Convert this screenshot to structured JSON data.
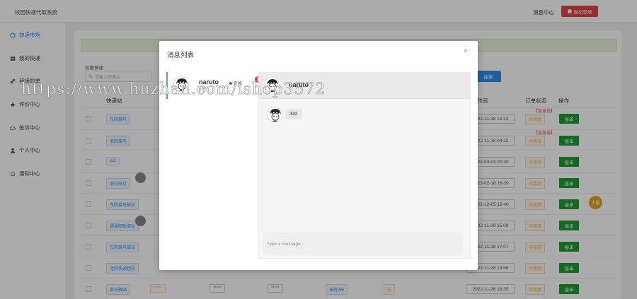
{
  "app": {
    "title": "校园快递代取系统",
    "message_center": "消息中心",
    "logout": "退出登录"
  },
  "sidebar": {
    "items": [
      {
        "label": "快递市场",
        "icon": "compass-icon",
        "active": true
      },
      {
        "label": "我的快递",
        "icon": "box-icon"
      },
      {
        "label": "我接的单",
        "icon": "link-icon"
      },
      {
        "label": "评价中心",
        "icon": "star-icon"
      },
      {
        "label": "投诉中心",
        "icon": "cloud-icon"
      },
      {
        "label": "个人中心",
        "icon": "user-icon"
      },
      {
        "label": "通知中心",
        "icon": "bell-icon"
      }
    ]
  },
  "search": {
    "label": "检索快递",
    "placeholder": "请输入快递点",
    "button": "搜索"
  },
  "table": {
    "headers": {
      "station": "快递站",
      "time": "时间",
      "status": "订单状态",
      "action": "操作"
    },
    "rows": [
      {
        "station": "东院菜鸟",
        "time": "2022-11-28 12:24",
        "status": "待接单",
        "urgent": "【加急送】",
        "action": "接单"
      },
      {
        "station": "南院菜鸟",
        "time": "2022-11-28 04:22",
        "status": "待接单",
        "urgent": "【加急送】",
        "action": "接单"
      },
      {
        "station": "xxz",
        "time": "2023-03-03 20:20",
        "status": "待接单",
        "action": "接单"
      },
      {
        "station": "测试支付",
        "time": "2023-02-18 16:39",
        "status": "待接单",
        "action": "接单"
      },
      {
        "station": "东院菜鸟驿站",
        "time": "2022-12-05 16:40",
        "status": "待接单",
        "action": "接单"
      },
      {
        "station": "圆通邮政驿站",
        "time": "2022-11-29 15:09",
        "status": "待接单",
        "action": "接单"
      },
      {
        "station": "东院菜鸟驿站",
        "time": "2022-11-28 17:07",
        "status": "待接单",
        "action": "接单"
      },
      {
        "station": "北院快递超市",
        "time": "2022-11-28 13:56",
        "status": "待接单",
        "action": "接单"
      },
      {
        "station": "菜鸟驿站",
        "time": "2022-11-26 16:35",
        "status": "待接单",
        "action": "接单",
        "masked": "*****",
        "station2": "东院2栋",
        "flag": "无"
      }
    ]
  },
  "float_tag": "大楼",
  "modal": {
    "title": "消息列表",
    "close": "×",
    "contact": {
      "name": "naruto",
      "online": "在线",
      "last_message": "332",
      "unread": "1"
    },
    "chat": {
      "name": "naruto",
      "messages": [
        {
          "text": "332"
        }
      ],
      "input_placeholder": "Type a message..."
    }
  },
  "watermark": "https://www.huzhan.com/ishop3572"
}
